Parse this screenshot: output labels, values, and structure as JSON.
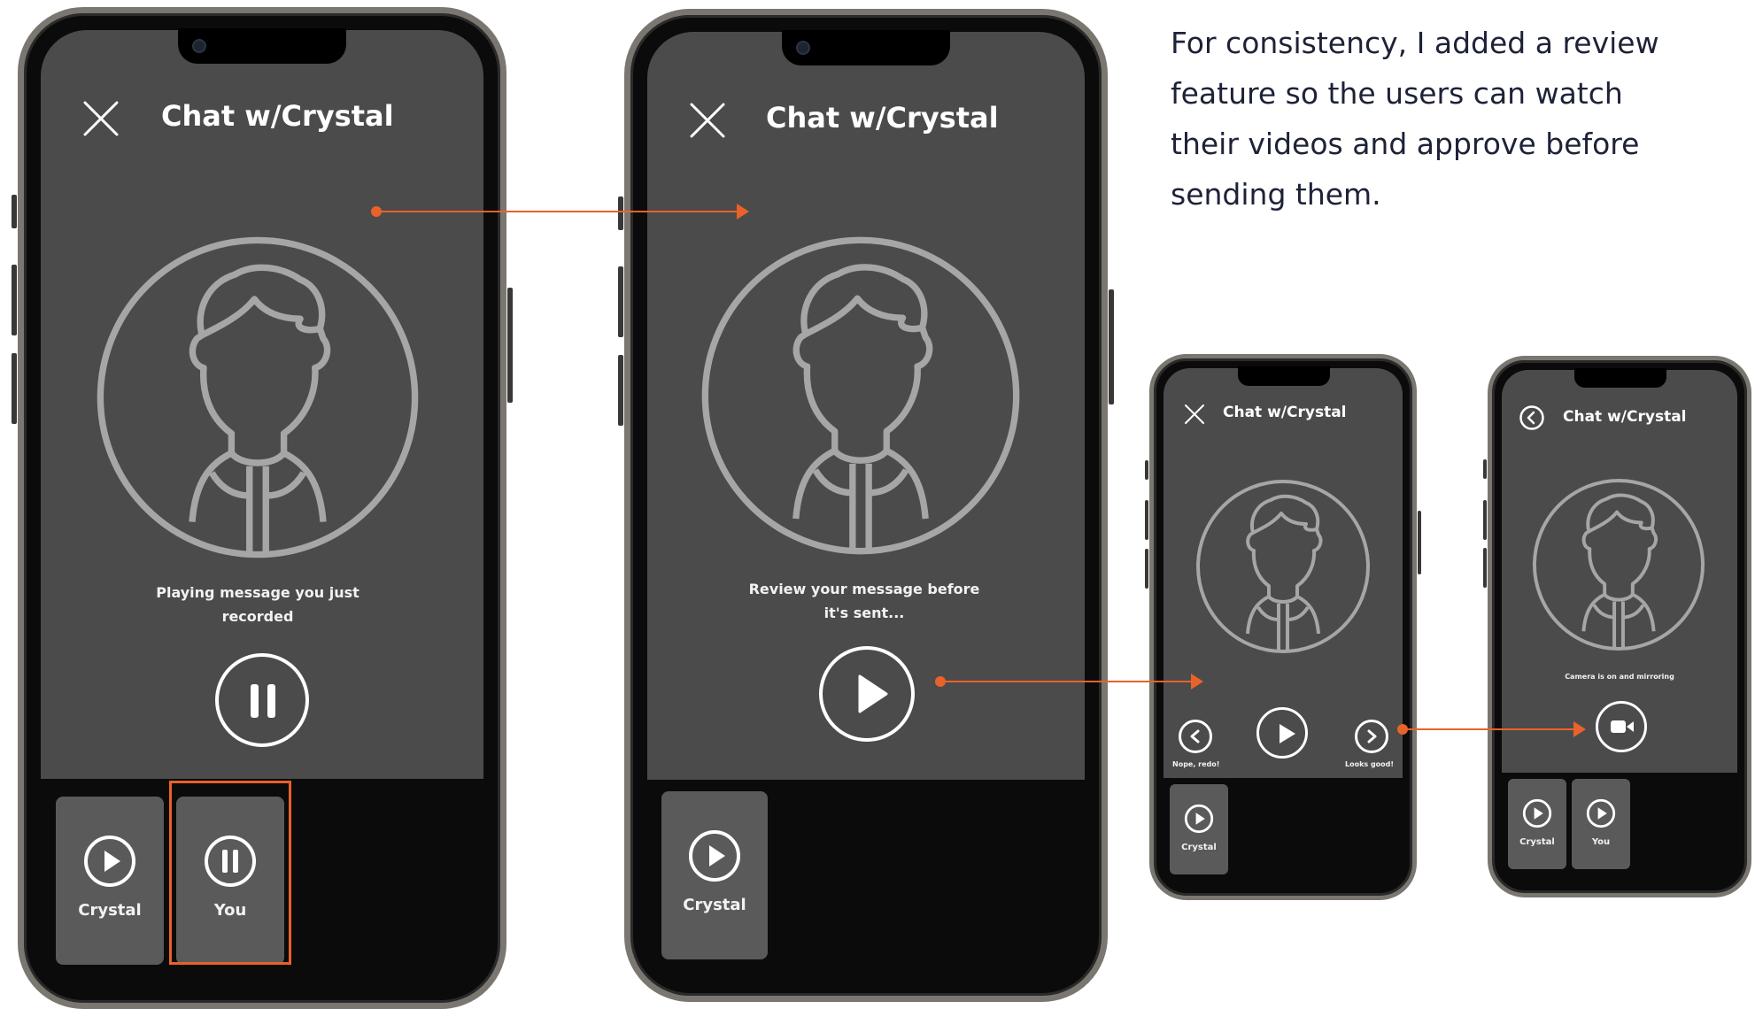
{
  "caption": "For consistency, I added a review feature so the users can watch their videos and approve before sending them.",
  "accent_color": "#e8622a",
  "screen_color": "#4b4b4b",
  "phones": [
    {
      "title": "Chat w/Crystal",
      "header_icon": "close-icon",
      "message": "Playing message you just recorded",
      "main_icon": "pause-icon",
      "tiles": [
        {
          "label": "Crystal",
          "icon": "play-icon"
        },
        {
          "label": "You",
          "icon": "pause-icon",
          "highlighted": true
        }
      ]
    },
    {
      "title": "Chat w/Crystal",
      "header_icon": "close-icon",
      "message": "Review your message before it's sent...",
      "main_icon": "play-icon",
      "tiles": [
        {
          "label": "Crystal",
          "icon": "play-icon"
        }
      ]
    },
    {
      "title": "Chat w/Crystal",
      "header_icon": "close-icon",
      "main_icon": "play-icon",
      "left_action": "Nope, redo!",
      "right_action": "Looks good!",
      "tiles": [
        {
          "label": "Crystal",
          "icon": "play-icon"
        }
      ]
    },
    {
      "title": "Chat w/Crystal",
      "header_icon": "back-icon",
      "message": "Camera is on and mirroring",
      "main_icon": "video-camera-icon",
      "tiles": [
        {
          "label": "Crystal",
          "icon": "play-icon"
        },
        {
          "label": "You",
          "icon": "play-icon"
        }
      ]
    }
  ]
}
